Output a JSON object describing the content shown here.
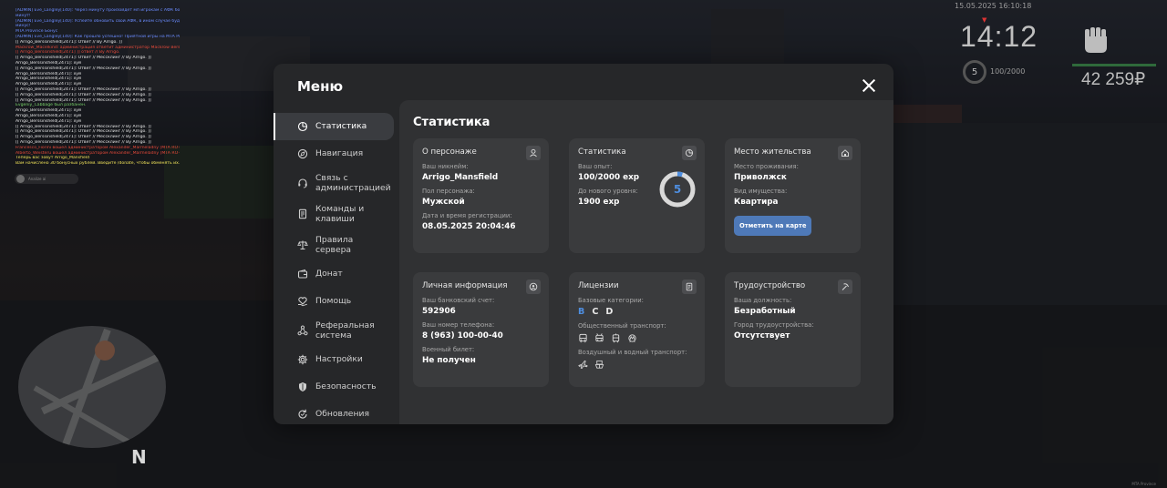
{
  "chat": {
    "lines": [
      {
        "text": "[ADMIN] Eve_Langley[140]: Через минуту произойдет мп игрокам с АФК более 30",
        "color": "#6b8cff"
      },
      {
        "text": "минут!",
        "color": "#6b8cff"
      },
      {
        "text": "[ADMIN] Eve_Langley[140]: Успейте обновить свой АФК, в ином случае будете на",
        "color": "#6b8cff"
      },
      {
        "text": "минус!",
        "color": "#6b8cff"
      },
      {
        "text": "MTA Province Бонус",
        "color": "#6b8cff"
      },
      {
        "text": "[ADMIN] Eve_Langley[140]: Как прошло успешно! Приятной игры на MTA Province!",
        "color": "#6b8cff"
      },
      {
        "text": "[[ Arrigo_Berssinsheld[2471]: Ответ // By Arrigo. ]]",
        "color": "#e6e6e6"
      },
      {
        "text": "Mackrow_Macelkind: администрация ответит администратор Mackrow Berserk Lincoln",
        "color": "#e84a3a"
      },
      {
        "text": "[[ Arrigo_Berssinsheld[2471] ]] ответ // By Arrigo.",
        "color": "#e84a3a"
      },
      {
        "text": "[[ Arrigo_Berssinsheld[2471]: Ответ // Мессклинг // By Arrigo. ]]",
        "color": "#e6e6e6"
      },
      {
        "text": "Arrigo_Berssinsheld[2471]: хуй",
        "color": "#e6e6e6"
      },
      {
        "text": "[[ Arrigo_Berssinsheld[2471]: Ответ // Мессклинг // By Arrigo. ]]",
        "color": "#e6e6e6"
      },
      {
        "text": "Arrigo_Berssinsheld[2471]: хуй",
        "color": "#e6e6e6"
      },
      {
        "text": "Arrigo_Berssinsheld[2471]: хуй",
        "color": "#e6e6e6"
      },
      {
        "text": "Arrigo_Berssinsheld[2471]: хуй",
        "color": "#e6e6e6"
      },
      {
        "text": "[[ Arrigo_Berssinsheld[2471]: Ответ // Мессклинг // By Arrigo. ]]",
        "color": "#e6e6e6"
      },
      {
        "text": "[[ Arrigo_Berssinsheld[2471]: Ответ // Мессклинг // By Arrigo. ]]",
        "color": "#e6e6e6"
      },
      {
        "text": "[[ Arrigo_Berssinsheld[2471]: Ответ // Мессклинг // By Arrigo. ]]",
        "color": "#e6e6e6"
      },
      {
        "text": "Evgeniy_Cabbage был разбанен.",
        "color": "#7ad36a"
      },
      {
        "text": "Arrigo_Berssinsheld[2471]: хуй",
        "color": "#e6e6e6"
      },
      {
        "text": "Arrigo_Berssinsheld[2471]: хуй",
        "color": "#e6e6e6"
      },
      {
        "text": "Arrigo_Berssinsheld[2471]: хуй",
        "color": "#e6e6e6"
      },
      {
        "text": "[[ Arrigo_Berssinsheld[2471]: Ответ // Мессклинг // By Arrigo. ]]",
        "color": "#e6e6e6"
      },
      {
        "text": "[[ Arrigo_Berssinsheld[2471]: Ответ // Мессклинг // By Arrigo. ]]",
        "color": "#e6e6e6"
      },
      {
        "text": "[[ Arrigo_Berssinsheld[2471]: Ответ // Мессклинг // By Arrigo. ]]",
        "color": "#e6e6e6"
      },
      {
        "text": "[[ Arrigo_Berssinsheld[2471]: Ответ // Мессклинг // By Arrigo. ]]",
        "color": "#e6e6e6"
      },
      {
        "text": "Francesco_Fiorini вошёл администратором Alexander_Marmeladny [MTA RO+]",
        "color": "#e84a3a"
      },
      {
        "text": "Alberto_Weisteru вошёл администратором Alexander_Marmeladny [MTA RO+]",
        "color": "#e84a3a"
      },
      {
        "text": "Теперь вас зовут Arrigo_Mansfield",
        "color": "#f2e45a"
      },
      {
        "text": "Вам начислено 30 бонусных рублей. Введите /donate, чтобы обменять их.",
        "color": "#f2e45a"
      }
    ],
    "input_placeholder": "Analize ai"
  },
  "hud": {
    "date": "15.05.2025 16:10:18",
    "time": "14:12",
    "level": "5",
    "exp": "100/2000",
    "money": "42 259₽",
    "watermark": "MTA Province"
  },
  "radar": {
    "north": "N"
  },
  "menu": {
    "title": "Меню",
    "sidebar": [
      {
        "label": "Статистика",
        "icon": "pie-chart-icon",
        "active": true
      },
      {
        "label": "Навигация",
        "icon": "compass-icon"
      },
      {
        "label": "Связь с администрацией",
        "icon": "headset-icon"
      },
      {
        "label": "Команды и клавиши",
        "icon": "document-icon"
      },
      {
        "label": "Правила сервера",
        "icon": "scales-icon"
      },
      {
        "label": "Донат",
        "icon": "wallet-icon"
      },
      {
        "label": "Помощь",
        "icon": "heart-hand-icon"
      },
      {
        "label": "Реферальная система",
        "icon": "network-icon"
      },
      {
        "label": "Настройки",
        "icon": "gear-icon"
      },
      {
        "label": "Безопасность",
        "icon": "shield-icon"
      },
      {
        "label": "Обновления",
        "icon": "refresh-icon"
      }
    ],
    "content_title": "Статистика",
    "cards": {
      "personal": {
        "title": "О персонаже",
        "nick_label": "Ваш никнейм:",
        "nick": "Arrigo_Mansfield",
        "gender_label": "Пол персонажа:",
        "gender": "Мужской",
        "reg_label": "Дата и время регистрации:",
        "reg": "08.05.2025 20:04:46"
      },
      "stats": {
        "title": "Статистика",
        "exp_label": "Ваш опыт:",
        "exp": "100/2000 exp",
        "next_label": "До нового уровня:",
        "next": "1900 exp",
        "level": "5",
        "progress": 0.05
      },
      "residence": {
        "title": "Место жительства",
        "place_label": "Место проживания:",
        "place": "Приволжск",
        "type_label": "Вид имущества:",
        "type": "Квартира",
        "button": "Отметить на карте"
      },
      "info": {
        "title": "Личная информация",
        "bank_label": "Ваш банковский счет:",
        "bank": "592906",
        "phone_label": "Ваш номер телефона:",
        "phone": "8 (963) 100-00-40",
        "military_label": "Военный билет:",
        "military": "Не получен"
      },
      "licenses": {
        "title": "Лицензии",
        "base_label": "Базовые категории:",
        "categories": [
          "B",
          "C",
          "D"
        ],
        "public_label": "Общественный транспорт:",
        "air_label": "Воздушный и водный транспорт:"
      },
      "employment": {
        "title": "Трудоустройство",
        "position_label": "Ваша должность:",
        "position": "Безработный",
        "city_label": "Город трудоустройства:",
        "city": "Отсутствует"
      }
    }
  }
}
